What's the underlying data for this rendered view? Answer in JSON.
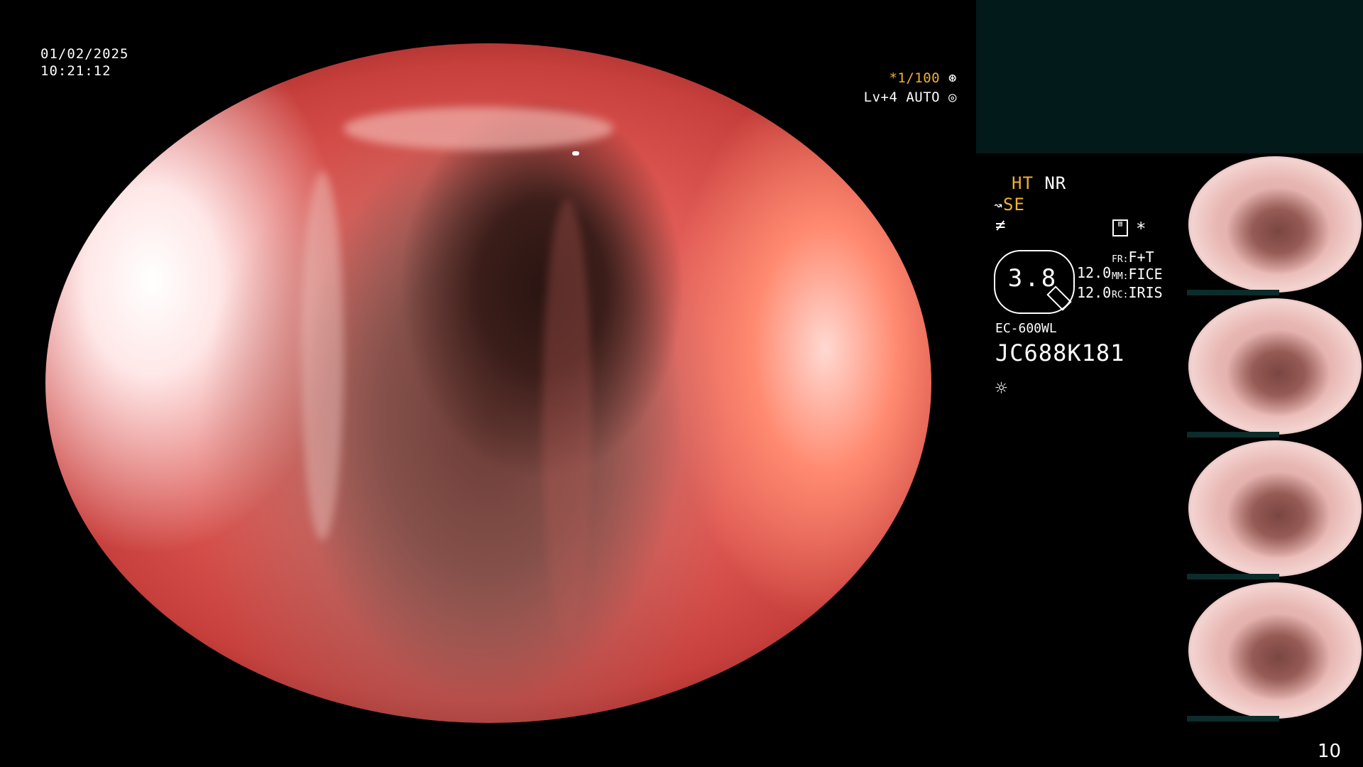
{
  "overlay": {
    "date": "01/02/2025",
    "time": "10:21:12",
    "shutter": "*1/100",
    "level": "Lv+4 AUTO"
  },
  "status": {
    "ht": "HT",
    "nr": "NR",
    "se": "SE",
    "se_prefix_icon": "scope-tilt-icon",
    "gauge_value": "3.8",
    "fr_label": "FR:",
    "fr_value": "F+T",
    "mm_label": "MM:",
    "mm_value": "FICE",
    "rc_label": "RC:",
    "rc_value": "IRIS",
    "row1_num": "12.0",
    "row2_num": "12.0",
    "model": "EC-600WL",
    "serial": "JC688K181",
    "asterisk": "*"
  },
  "page_number": "10",
  "colors": {
    "accent_yellow": "#f0b030",
    "panel_teal": "#031a1a"
  }
}
